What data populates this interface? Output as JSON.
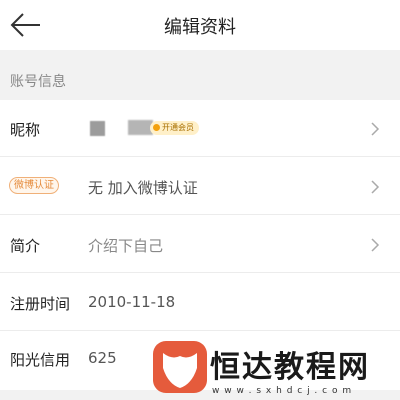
{
  "header": {
    "title": "编辑资料",
    "back_icon": "arrow-left-icon"
  },
  "section": {
    "title": "账号信息"
  },
  "rows": {
    "nickname": {
      "label": "昵称",
      "vip_badge": "开通会员"
    },
    "weibo": {
      "badge": "微博认证",
      "value": "无 加入微博认证"
    },
    "intro": {
      "label": "简介",
      "value": "介绍下自己"
    },
    "register": {
      "label": "注册时间",
      "value": "2010-11-18"
    },
    "credit": {
      "label": "阳光信用",
      "value": "625"
    }
  },
  "watermark": {
    "title": "恒达教程网",
    "url": "w w w . s x h d c j . c o m"
  },
  "colors": {
    "accent": "#e55b3c",
    "badge_orange": "#e58b3c",
    "vip_gold": "#f3a10d"
  }
}
